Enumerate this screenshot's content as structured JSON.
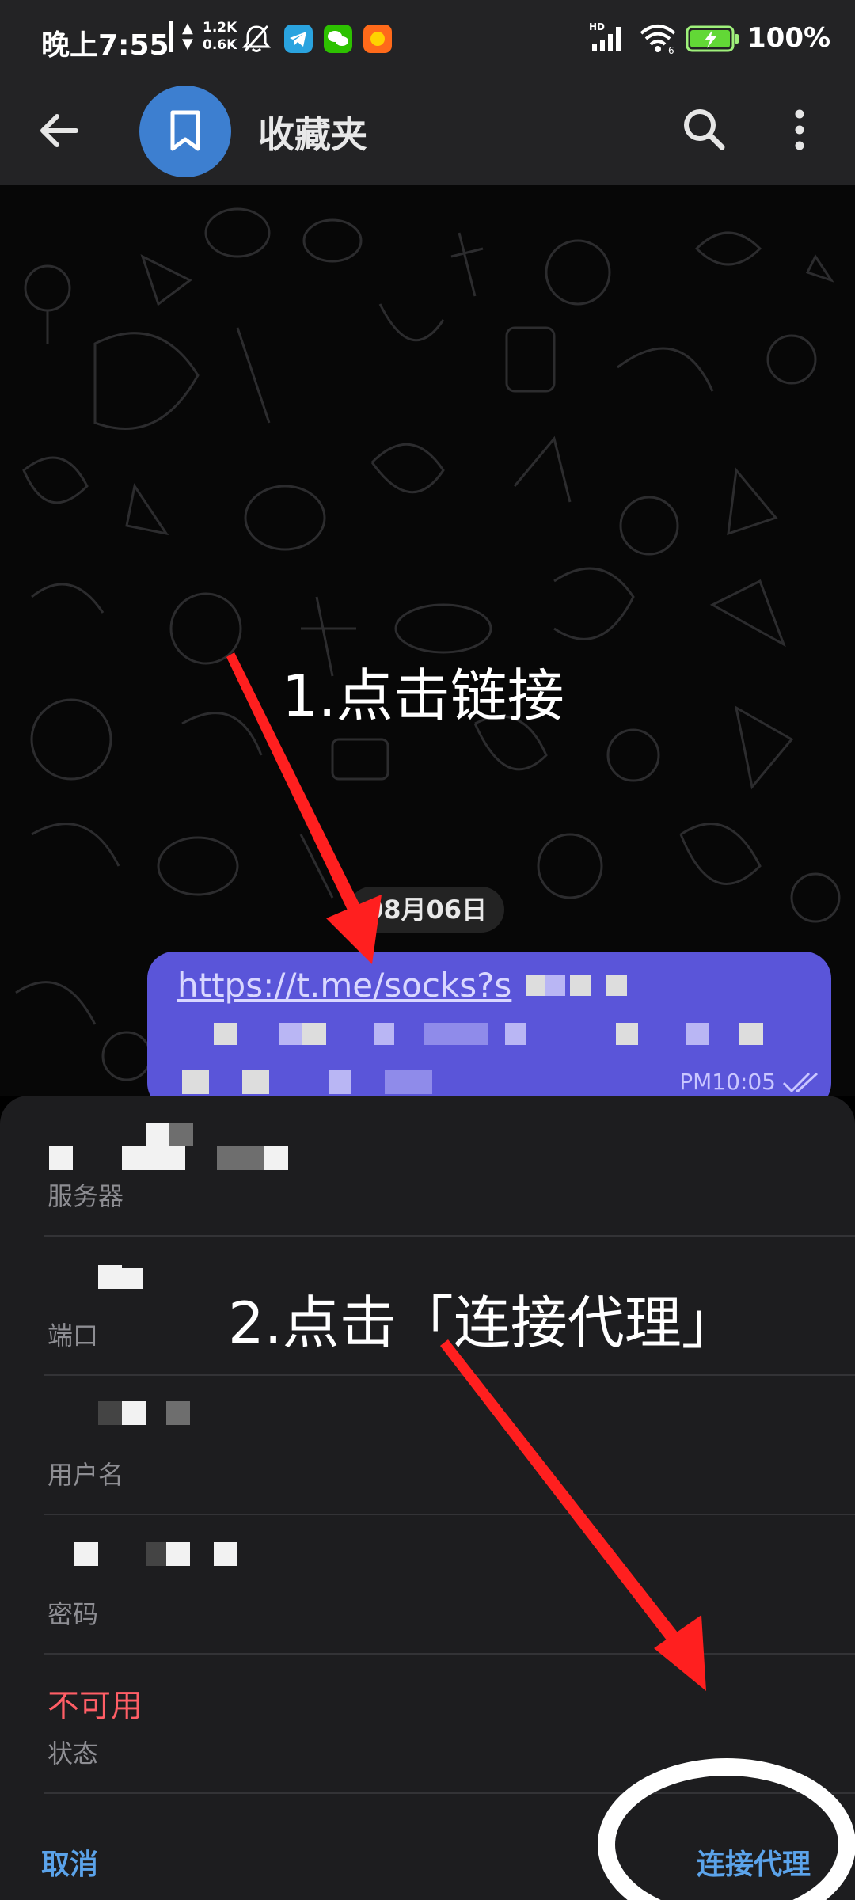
{
  "status_bar": {
    "time": "晚上7:55",
    "net_up": "1.2K",
    "net_down": "0.6K",
    "battery": "100%",
    "icons": [
      "mute-bell-icon",
      "telegram-icon",
      "wechat-icon",
      "app-icon",
      "hd-signal-icon",
      "wifi-icon",
      "battery-icon"
    ]
  },
  "header": {
    "title": "收藏夹",
    "avatar_icon": "bookmark-icon",
    "avatar_color": "#3d7fd0"
  },
  "chat": {
    "date": "08月06日",
    "message": {
      "link": "https://t.me/socks?s",
      "time": "PM10:05",
      "bubble_color": "#5a55d9"
    }
  },
  "sheet": {
    "rows": [
      {
        "label": "服务器"
      },
      {
        "label": "端口"
      },
      {
        "label": "用户名"
      },
      {
        "label": "密码"
      },
      {
        "label": "状态",
        "value": "不可用"
      }
    ],
    "cancel": "取消",
    "connect": "连接代理",
    "accent": "#5ba3ea",
    "error_color": "#ff5e66"
  },
  "annotations": {
    "step1": "1.点击链接",
    "step2": "2.点击「连接代理」"
  }
}
